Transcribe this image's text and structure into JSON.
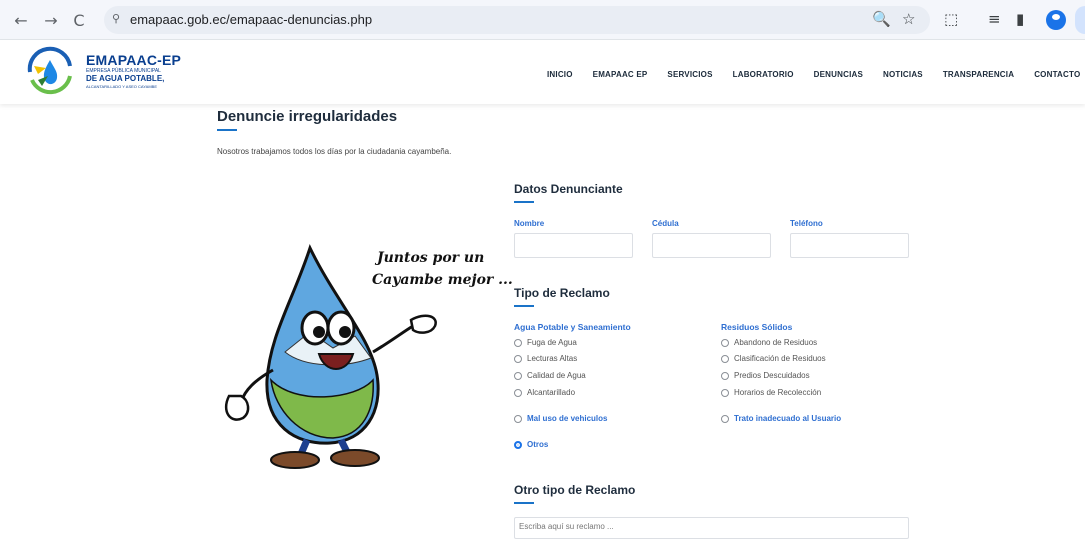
{
  "browser": {
    "url": "emapaac.gob.ec/emapaac-denuncias.php",
    "back_icon": "←",
    "forward_icon": "→",
    "reload_icon": "C",
    "site_info_icon": "⚲",
    "zoom_icon": "🔍",
    "star_icon": "☆",
    "extensions_icon": "⬚",
    "reading_list_icon": "≡",
    "sidepanel_icon": "▮"
  },
  "site": {
    "logo_title": "EMAPAAC-EP",
    "logo_sub1": "EMPRESA PÚBLICA MUNICIPAL",
    "logo_sub2": "DE AGUA POTABLE,",
    "logo_sub3": "ALCANTARILLADO Y ASEO CAYAMBE",
    "menu": [
      "INICIO",
      "EMAPAAC EP",
      "SERVICIOS",
      "LABORATORIO",
      "DENUNCIAS",
      "NOTICIAS",
      "TRANSPARENCIA",
      "CONTACTO"
    ]
  },
  "page": {
    "title": "Denuncie irregularidades",
    "intro": "Nosotros trabajamos todos los días por la ciudadania cayambeña.",
    "slogan_line1": "Juntos por un",
    "slogan_line2": "Cayambe mejor ..."
  },
  "form": {
    "datos_title": "Datos Denunciante",
    "fields": [
      {
        "label": "Nombre",
        "value": ""
      },
      {
        "label": "Cédula",
        "value": ""
      },
      {
        "label": "Teléfono",
        "value": ""
      }
    ],
    "tipo_title": "Tipo de Reclamo",
    "group_agua": {
      "label": "Agua Potable y Saneamiento",
      "options": [
        "Fuga de Agua",
        "Lecturas Altas",
        "Calidad de Agua",
        "Alcantarillado"
      ]
    },
    "group_residuos": {
      "label": "Residuos Sólidos",
      "options": [
        "Abandono de Residuos",
        "Clasificación de Residuos",
        "Predios Descuidados",
        "Horarios de Recolección"
      ]
    },
    "mal_uso": "Mal uso de vehiculos",
    "trato": "Trato inadecuado al Usuario",
    "otros": "Otros",
    "selected": "Otros",
    "otro_title": "Otro tipo de Reclamo",
    "otro_placeholder": "Escriba aquí su reclamo ..."
  },
  "colors": {
    "accent": "#2f6fd1",
    "brand": "#0a3f8f"
  }
}
